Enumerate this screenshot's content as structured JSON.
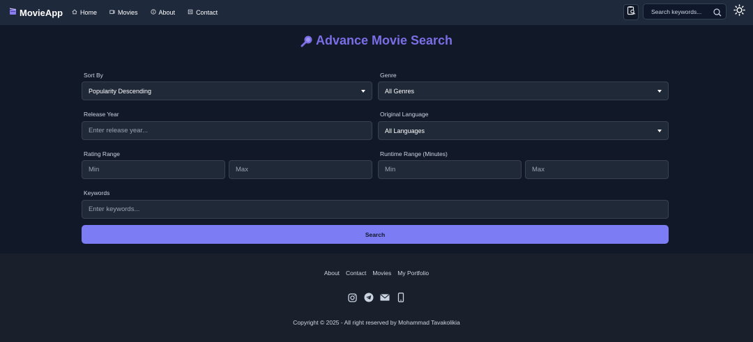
{
  "brand": {
    "name": "MovieApp",
    "icon": "clapperboard-icon"
  },
  "nav": {
    "links": [
      {
        "label": "Home",
        "icon": "home-icon"
      },
      {
        "label": "Movies",
        "icon": "film-icon"
      },
      {
        "label": "About",
        "icon": "info-icon"
      },
      {
        "label": "Contact",
        "icon": "contact-icon"
      }
    ],
    "search_placeholder": "Search keywords..."
  },
  "page": {
    "title": "Advance Movie Search"
  },
  "form": {
    "sort_by": {
      "label": "Sort By",
      "value": "Popularity Descending"
    },
    "genre": {
      "label": "Genre",
      "value": "All Genres"
    },
    "release_year": {
      "label": "Release Year",
      "placeholder": "Enter release year..."
    },
    "language": {
      "label": "Original Language",
      "value": "All Languages"
    },
    "rating": {
      "label": "Rating Range",
      "min_placeholder": "Min",
      "max_placeholder": "Max"
    },
    "runtime": {
      "label": "Runtime Range (Minutes)",
      "min_placeholder": "Min",
      "max_placeholder": "Max"
    },
    "keywords": {
      "label": "Keywords",
      "placeholder": "Enter keywords..."
    },
    "submit_label": "Search"
  },
  "footer": {
    "links": [
      "About",
      "Contact",
      "Movies",
      "My Portfolio"
    ],
    "social": [
      "instagram-icon",
      "telegram-icon",
      "email-icon",
      "phone-icon"
    ],
    "copyright": "Copyright © 2025 - All right reserved by Mohammad Tavakolikia"
  },
  "colors": {
    "nav_bg": "#1e293b",
    "main_bg": "#111827",
    "footer_bg": "#1a202b",
    "accent": "#7c6ee6",
    "button": "#7c7cf5"
  }
}
